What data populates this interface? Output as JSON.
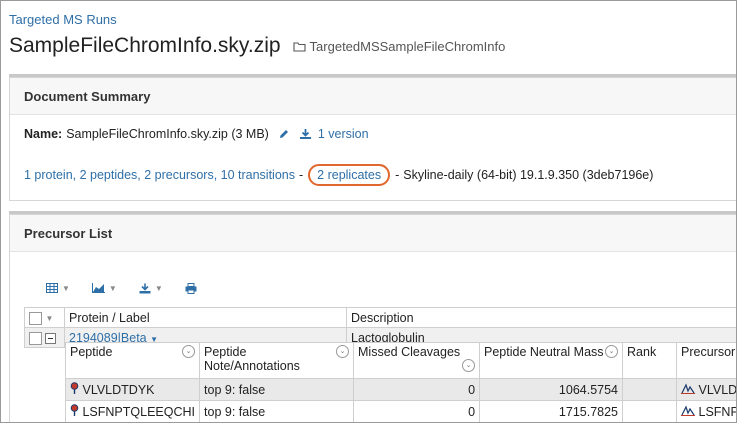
{
  "breadcrumb": "Targeted MS Runs",
  "page_title": "SampleFileChromInfo.sky.zip",
  "folder_name": "TargetedMSSampleFileChromInfo",
  "summary": {
    "heading": "Document Summary",
    "name_label": "Name:",
    "name_value": "SampleFileChromInfo.sky.zip (3 MB)",
    "versions_link": "1 version",
    "counts_link": "1 protein, 2 peptides, 2 precursors, 10 transitions",
    "separator": "-",
    "replicates_link": "2 replicates",
    "software": "Skyline-daily (64-bit) 19.1.9.350 (3deb7196e)"
  },
  "precursor_list": {
    "heading": "Precursor List",
    "columns": [
      "Protein / Label",
      "Description"
    ],
    "group": {
      "protein": "2194089|Beta",
      "description": "Lactoglobulin"
    },
    "sub_columns": [
      "Peptide",
      "Peptide Note/Annotations",
      "Missed Cleavages",
      "Peptide Neutral Mass",
      "Rank",
      "Precursor"
    ],
    "rows": [
      {
        "peptide": "VLVLDTDYK",
        "note": "top 9: false",
        "missed": "0",
        "mass": "1064.5754",
        "precursor": "VLVLDT"
      },
      {
        "peptide": "LSFNPTQLEEQCHI",
        "note": "top 9: false",
        "missed": "0",
        "mass": "1715.7825",
        "precursor": "LSFNPT"
      }
    ]
  },
  "colors": {
    "link": "#2f6fa7",
    "highlight_oval": "#e0672e"
  },
  "icons": [
    "folder-icon",
    "pencil-icon",
    "download-icon",
    "grid-icon",
    "chart-icon",
    "export-icon",
    "print-icon",
    "pin-icon",
    "chromatogram-icon"
  ]
}
